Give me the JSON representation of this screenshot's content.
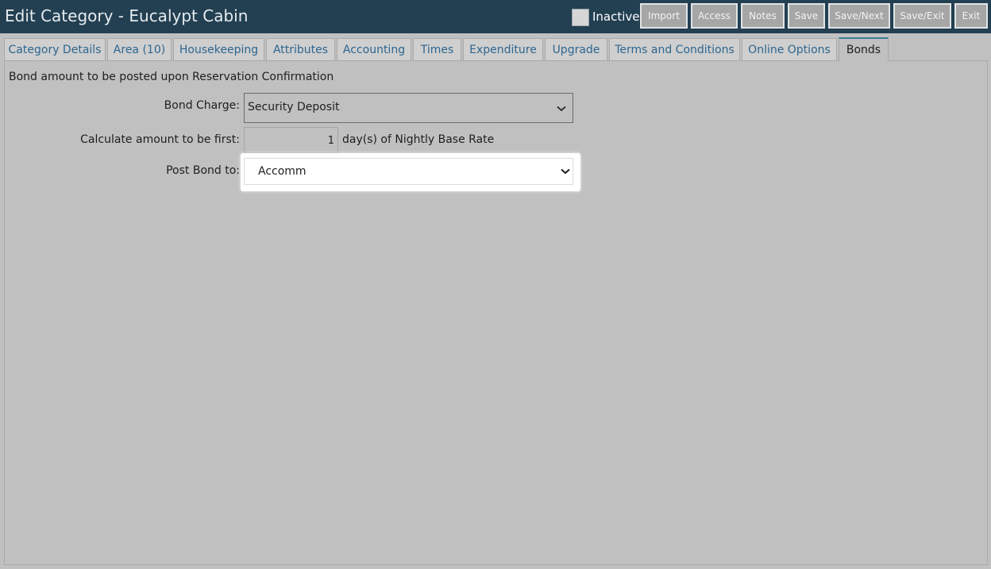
{
  "header": {
    "title": "Edit Category - Eucalypt Cabin",
    "inactive_label": "Inactive",
    "buttons": {
      "import": "Import",
      "access": "Access",
      "notes": "Notes",
      "save": "Save",
      "save_next": "Save/Next",
      "save_exit": "Save/Exit",
      "exit": "Exit"
    }
  },
  "tabs": {
    "category_details": "Category Details",
    "area": "Area (10)",
    "housekeeping": "Housekeeping",
    "attributes": "Attributes",
    "accounting": "Accounting",
    "times": "Times",
    "expenditure": "Expenditure",
    "upgrade": "Upgrade",
    "terms": "Terms and Conditions",
    "online_options": "Online Options",
    "bonds": "Bonds"
  },
  "bonds": {
    "intro": "Bond amount to be posted upon Reservation Confirmation",
    "bond_charge_label": "Bond Charge:",
    "bond_charge_value": "Security Deposit",
    "calc_label": "Calculate amount to be first:",
    "calc_days": "1",
    "calc_suffix": "day(s) of Nightly Base Rate",
    "post_label": "Post Bond to:",
    "post_value": "Accomm"
  }
}
